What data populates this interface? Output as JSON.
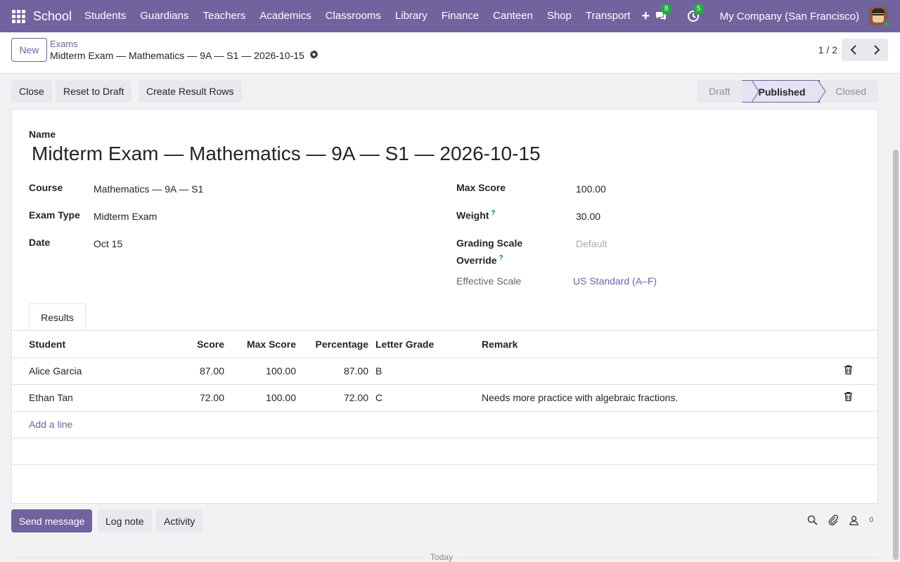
{
  "navbar": {
    "brand": "School",
    "menu": [
      "Students",
      "Guardians",
      "Teachers",
      "Academics",
      "Classrooms",
      "Library",
      "Finance",
      "Canteen",
      "Shop",
      "Transport"
    ],
    "plus_icon": "+",
    "messages_badge": "8",
    "activities_badge": "5",
    "company": "My Company (San Francisco)",
    "accent_color": "#71639e"
  },
  "control_panel": {
    "new_label": "New",
    "breadcrumb_parent": "Exams",
    "breadcrumb_current": "Midterm Exam — Mathematics — 9A — S1 — 2026-10-15",
    "pager_value": "1 / 2"
  },
  "statusbar": {
    "buttons": [
      "Close",
      "Reset to Draft",
      "Create Result Rows"
    ],
    "stages": [
      "Draft",
      "Published",
      "Closed"
    ],
    "active_stage": "Published"
  },
  "form": {
    "name_label": "Name",
    "name_value": "Midterm Exam — Mathematics — 9A — S1 — 2026-10-15",
    "course_label": "Course",
    "course_value": "Mathematics — 9A — S1",
    "exam_type_label": "Exam Type",
    "exam_type_value": "Midterm Exam",
    "date_label": "Date",
    "date_value": "Oct 15",
    "max_score_label": "Max Score",
    "max_score_value": "100.00",
    "weight_label": "Weight",
    "weight_value": "30.00",
    "grading_scale_label_1": "Grading Scale",
    "grading_scale_label_2": "Override",
    "grading_scale_placeholder": "Default",
    "effective_scale_label": "Effective Scale",
    "effective_scale_value": "US Standard (A–F)",
    "help_mark": "?"
  },
  "results_tab": {
    "tab_label": "Results",
    "columns": [
      "Student",
      "Score",
      "Max Score",
      "Percentage",
      "Letter Grade",
      "Remark"
    ],
    "rows": [
      {
        "student": "Alice Garcia",
        "score": "87.00",
        "max_score": "100.00",
        "percentage": "87.00",
        "grade": "B",
        "remark": ""
      },
      {
        "student": "Ethan Tan",
        "score": "72.00",
        "max_score": "100.00",
        "percentage": "72.00",
        "grade": "C",
        "remark": "Needs more practice with algebraic fractions."
      }
    ],
    "add_line_label": "Add a line"
  },
  "chatter": {
    "send_message_label": "Send message",
    "log_note_label": "Log note",
    "activity_label": "Activity",
    "followers_count": "0",
    "today_label": "Today"
  }
}
